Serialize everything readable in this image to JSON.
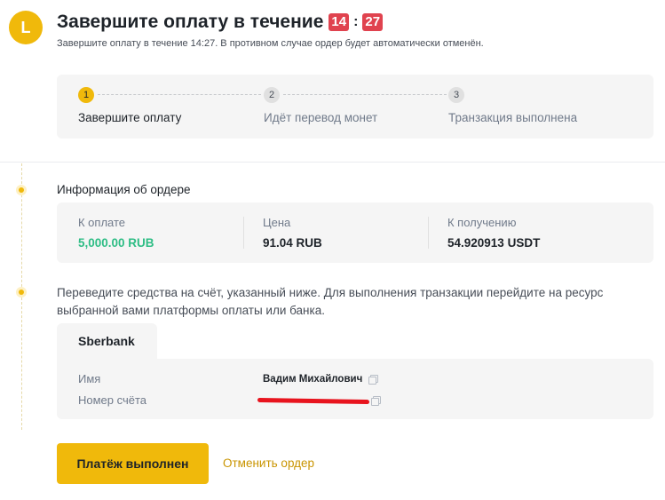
{
  "header": {
    "avatar_letter": "L",
    "title": "Завершите оплату в течение",
    "timer_minutes": "14",
    "timer_separator": ":",
    "timer_seconds": "27",
    "subtitle": "Завершите оплату в течение 14:27. В противном случае ордер будет автоматически отменён."
  },
  "steps": [
    {
      "number": "1",
      "label": "Завершите оплату",
      "active": true
    },
    {
      "number": "2",
      "label": "Идёт перевод монет",
      "active": false
    },
    {
      "number": "3",
      "label": "Транзакция выполнена",
      "active": false
    }
  ],
  "order_info": {
    "title": "Информация об ордере",
    "amount_label": "К оплате",
    "amount_value": "5,000.00 RUB",
    "price_label": "Цена",
    "price_value": "91.04 RUB",
    "receive_label": "К получению",
    "receive_value": "54.920913 USDT"
  },
  "transfer": {
    "instructions": "Переведите средства на счёт, указанный ниже. Для выполнения транзакции перейдите на ресурс выбранной вами платформы оплаты или банка.",
    "bank_name": "Sberbank",
    "name_label": "Имя",
    "name_value": "Вадим Михайлович",
    "account_label": "Номер счёта"
  },
  "actions": {
    "paid_button": "Платёж выполнен",
    "cancel_link": "Отменить ордер"
  },
  "colors": {
    "accent": "#f0b90b",
    "timer": "#e0434f",
    "amount_green": "#2ebd85",
    "link": "#c99400",
    "redaction": "#e8141e"
  }
}
